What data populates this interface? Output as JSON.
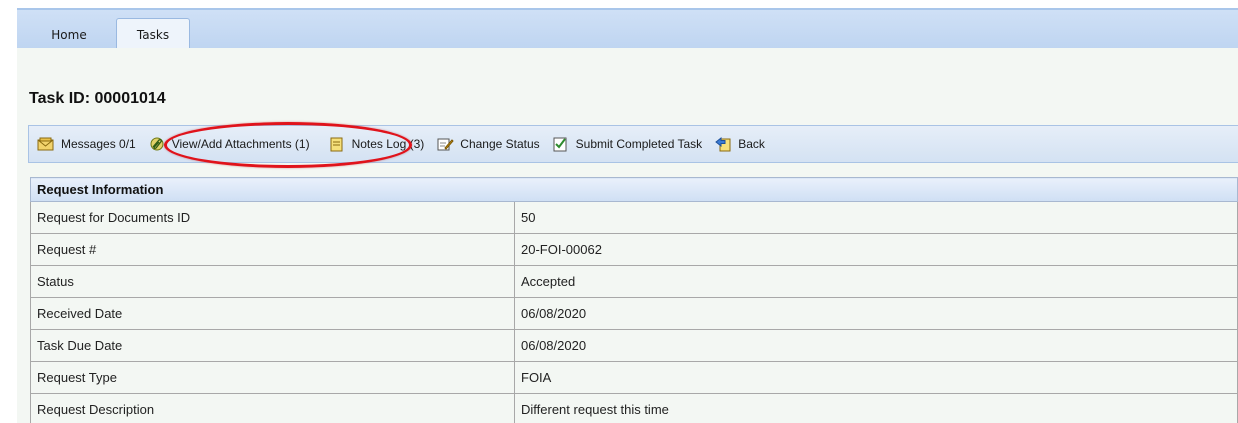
{
  "tabs": [
    {
      "label": "Home"
    },
    {
      "label": "Tasks"
    }
  ],
  "page": {
    "title": "Task ID: 00001014"
  },
  "toolbar": {
    "messages": "Messages 0/1",
    "attachments": "View/Add Attachments (1)",
    "notes": "Notes Log (3)",
    "change_status": "Change Status",
    "submit": "Submit Completed Task",
    "back": "Back"
  },
  "request_info": {
    "header": "Request Information",
    "rows": [
      {
        "label": "Request for Documents ID",
        "value": "50"
      },
      {
        "label": "Request #",
        "value": "20-FOI-00062"
      },
      {
        "label": "Status",
        "value": "Accepted"
      },
      {
        "label": "Received Date",
        "value": "06/08/2020"
      },
      {
        "label": "Task Due Date",
        "value": "06/08/2020"
      },
      {
        "label": "Request Type",
        "value": "FOIA"
      },
      {
        "label": "Request Description",
        "value": "Different request this time"
      }
    ]
  },
  "colors": {
    "highlight": "#e0131b",
    "tabbar": "#cfe0f6",
    "header_row": "#cfdff4"
  }
}
